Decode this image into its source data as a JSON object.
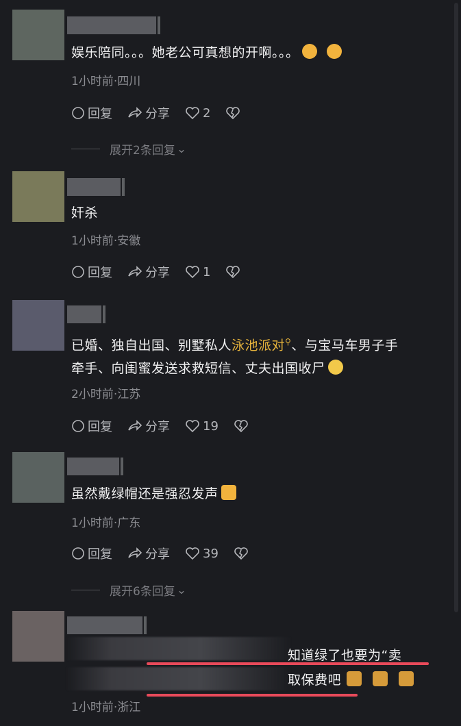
{
  "actions": {
    "reply": "回复",
    "share": "分享"
  },
  "comments": [
    {
      "text": "娱乐陪同。。。她老公可真想的开啊。。。",
      "meta": "1小时前·四川",
      "likes": "2",
      "expand": "展开2条回复",
      "avatar_color": "#5e6660"
    },
    {
      "text": "奸杀",
      "meta": "1小时前·安徽",
      "likes": "1",
      "avatar_color": "#7a7a5a"
    },
    {
      "text_a": "已婚、独自出国、别墅私人",
      "text_highlight": "泳池派对",
      "text_b": "、与宝马车男子手",
      "text_line2": "牵手、向闺蜜发送求救短信、丈夫出国收尸",
      "meta": "2小时前·江苏",
      "likes": "19",
      "avatar_color": "#5a5b6c"
    },
    {
      "text": "虽然戴绿帽还是强忍发声",
      "meta": "1小时前·广东",
      "likes": "39",
      "expand": "展开6条回复",
      "avatar_color": "#5a6260"
    },
    {
      "text_line1_tail": "知道绿了也要为“卖",
      "text_line2_tail": "取保费吧",
      "meta": "1小时前·浙江",
      "avatar_color": "#6a6262"
    }
  ],
  "colors": {
    "highlight": "#e7b43c",
    "underline": "#e84a5a",
    "background": "#1b1c20"
  }
}
